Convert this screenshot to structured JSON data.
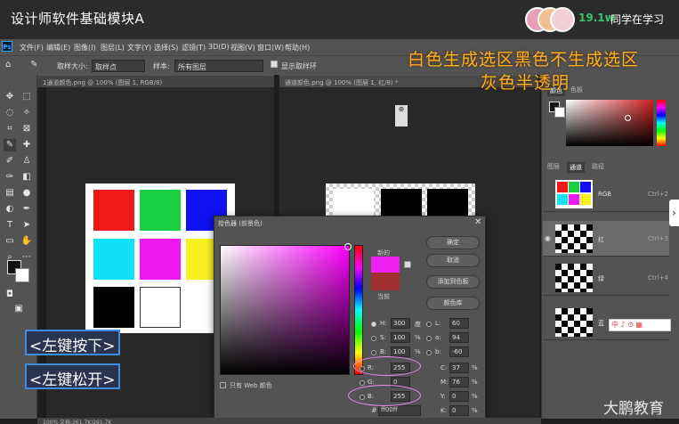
{
  "course": {
    "title": "设计师软件基础模块A",
    "viewer_count": "19.1w",
    "viewer_text": "同学在学习"
  },
  "menu": [
    "文件(F)",
    "编辑(E)",
    "图像(I)",
    "图层(L)",
    "文字(Y)",
    "选择(S)",
    "滤镜(T)",
    "3D(D)",
    "视图(V)",
    "窗口(W)",
    "帮助(H)"
  ],
  "options": {
    "sample_size_label": "取样大小:",
    "sample_size_value": "取样点",
    "sample_label": "样本:",
    "sample_value": "所有图层",
    "show_ring_label": "显示取样环"
  },
  "docs": {
    "left_tab": "1通道颜色.png @ 100% (图层 1, RGB/8)",
    "right_tab": "通道颜色.png @ 100% (图层 1, 红/8) *"
  },
  "annotation": {
    "line1": "白色生成选区黑色不生成选区",
    "line2": "灰色半透明"
  },
  "keys": {
    "press": "<左键按下>",
    "release": "<左键松开>"
  },
  "picker": {
    "title": "拾色器 (前景色)",
    "new_label": "新的",
    "current_label": "当前",
    "ok": "确定",
    "cancel": "取消",
    "add_swatch": "添加到色板",
    "color_libraries": "颜色库",
    "only_web": "只有 Web 颜色",
    "fields": {
      "H": "300",
      "H_unit": "度",
      "S": "100",
      "S_unit": "%",
      "B": "100",
      "B_unit": "%",
      "R": "255",
      "G": "0",
      "Bl": "255",
      "L": "60",
      "a": "94",
      "b": "-60",
      "C": "37",
      "M": "76",
      "Y": "0",
      "K": "0"
    },
    "hex": "ff00ff",
    "new_color": "#ff20ff",
    "current_color": "#a03030"
  },
  "right_panel": {
    "tabs_top": [
      "颜色",
      "色板"
    ],
    "tabs_bottom": [
      "图层",
      "通道",
      "路径"
    ],
    "channels": [
      {
        "name": "RGB",
        "key": "Ctrl+2"
      },
      {
        "name": "红",
        "key": "Ctrl+3"
      },
      {
        "name": "绿",
        "key": "Ctrl+4"
      },
      {
        "name": "蓝",
        "key": "Ctrl+5"
      }
    ]
  },
  "ime": "中 ♪ ⊙ ▦",
  "status": "100%    文档:261.7K/261.7K",
  "watermark": "大鹏教育"
}
